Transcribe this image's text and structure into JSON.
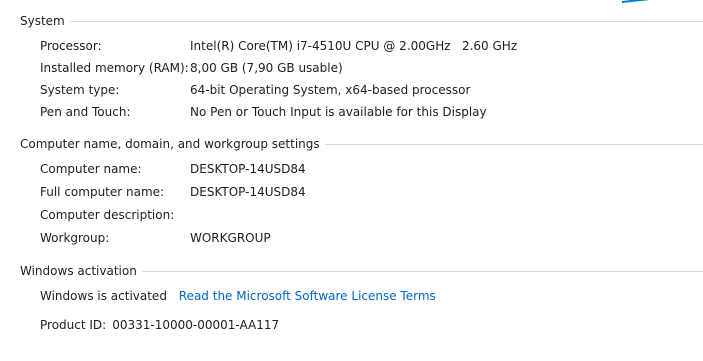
{
  "system": {
    "header": "System",
    "rows": [
      {
        "label": "Processor:",
        "value": "Intel(R) Core(TM) i7-4510U CPU @ 2.00GHz   2.60 GHz"
      },
      {
        "label": "Installed memory (RAM):",
        "value": "8,00 GB (7,90 GB usable)"
      },
      {
        "label": "System type:",
        "value": "64-bit Operating System, x64-based processor"
      },
      {
        "label": "Pen and Touch:",
        "value": "No Pen or Touch Input is available for this Display"
      }
    ]
  },
  "computer_name": {
    "header": "Computer name, domain, and workgroup settings",
    "rows": [
      {
        "label": "Computer name:",
        "value": "DESKTOP-14USD84"
      },
      {
        "label": "Full computer name:",
        "value": "DESKTOP-14USD84"
      },
      {
        "label": "Computer description:",
        "value": ""
      },
      {
        "label": "Workgroup:",
        "value": "WORKGROUP"
      }
    ]
  },
  "activation": {
    "header": "Windows activation",
    "status": "Windows is activated",
    "license_link": "Read the Microsoft Software License Terms",
    "product_id_label": "Product ID:",
    "product_id_value": "00331-10000-00001-AA117"
  },
  "colors": {
    "link": "#0066cc",
    "rule": "#d9d9d9",
    "logo": "#0078d7"
  },
  "icons": {
    "corner_logo": "windows-logo-icon"
  }
}
